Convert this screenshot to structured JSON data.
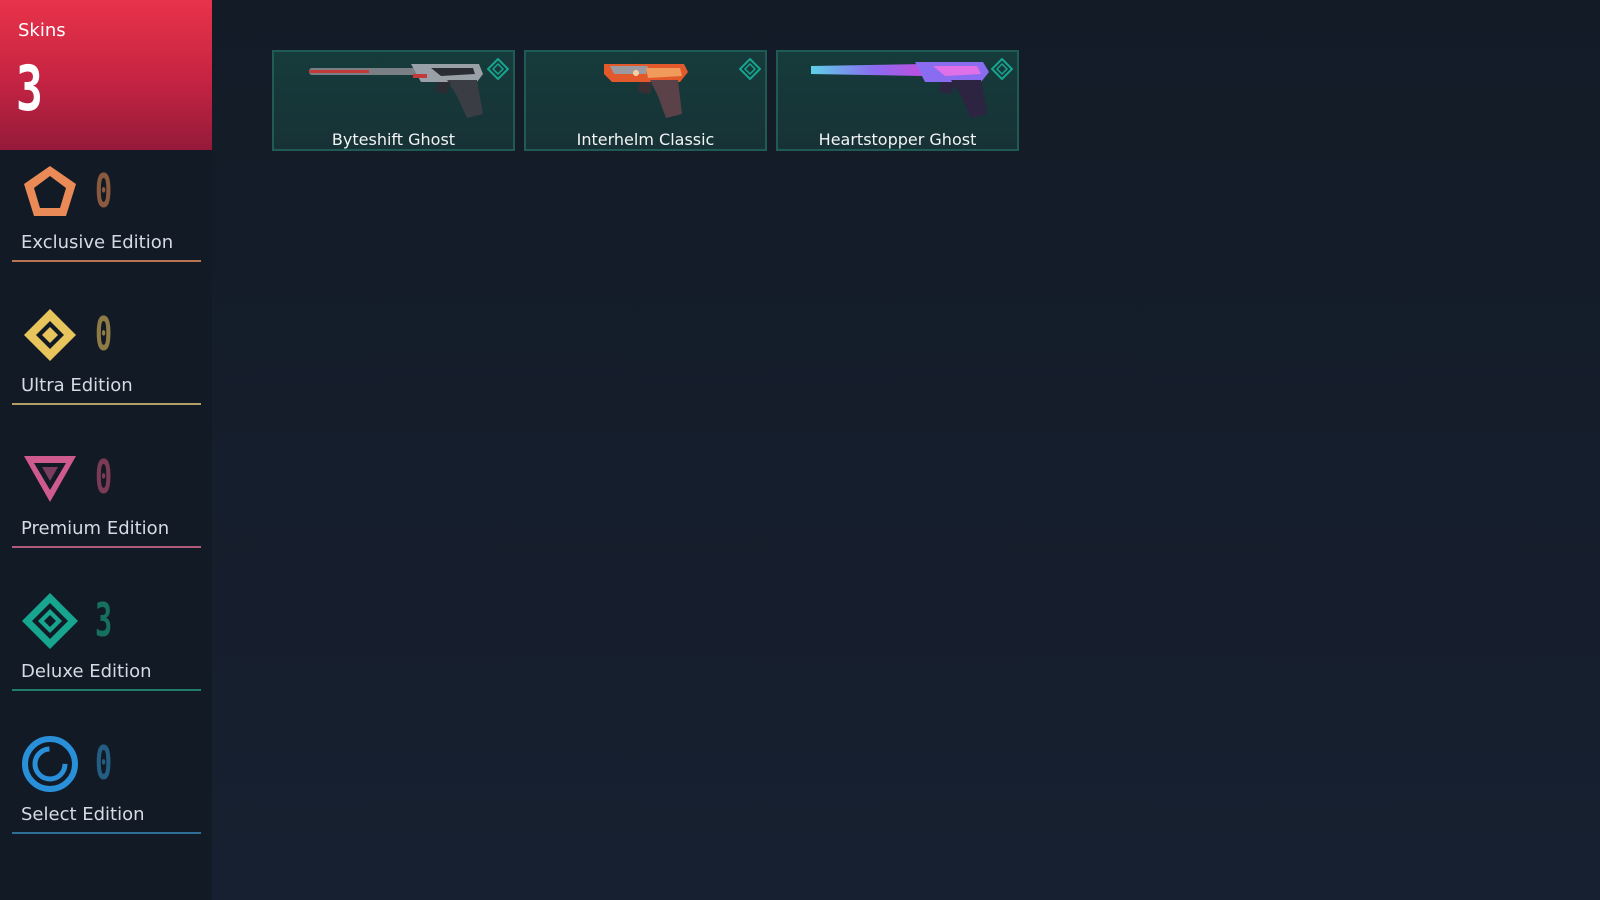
{
  "summary": {
    "label": "Skins",
    "total": "3"
  },
  "editions": [
    {
      "name": "Exclusive Edition",
      "count": "0",
      "icon": "exclusive-edition-icon",
      "color": "#e98a57",
      "count_color": "#8a5a3e",
      "line_color": "#b87453"
    },
    {
      "name": "Ultra Edition",
      "count": "0",
      "icon": "ultra-edition-icon",
      "color": "#e7c45c",
      "count_color": "#8d7a45",
      "line_color": "#b39e64"
    },
    {
      "name": "Premium Edition",
      "count": "0",
      "icon": "premium-edition-icon",
      "color": "#cf5a8e",
      "count_color": "#7b3a55",
      "line_color": "#b05b7c"
    },
    {
      "name": "Deluxe Edition",
      "count": "3",
      "icon": "deluxe-edition-icon",
      "color": "#17a58f",
      "count_color": "#16705f",
      "line_color": "#1f7d6e"
    },
    {
      "name": "Select Edition",
      "count": "0",
      "icon": "select-edition-icon",
      "color": "#2a8fd9",
      "count_color": "#245d82",
      "line_color": "#2f6f97"
    }
  ],
  "skins": [
    {
      "name": "Byteshift Ghost",
      "tier": "deluxe",
      "tier_icon": "deluxe-tier-icon",
      "gun_icon": "ghost-pistol-icon",
      "colors": [
        "#7a7f86",
        "#c23a3a",
        "#2a2d33"
      ]
    },
    {
      "name": "Interhelm Classic",
      "tier": "deluxe",
      "tier_icon": "deluxe-tier-icon",
      "gun_icon": "classic-pistol-icon",
      "colors": [
        "#9b9aa0",
        "#e25a2c",
        "#3a3034"
      ]
    },
    {
      "name": "Heartstopper Ghost",
      "tier": "deluxe",
      "tier_icon": "deluxe-tier-icon",
      "gun_icon": "ghost-pistol-icon",
      "colors": [
        "#5fd0e8",
        "#c04de0",
        "#2c2440"
      ]
    }
  ]
}
